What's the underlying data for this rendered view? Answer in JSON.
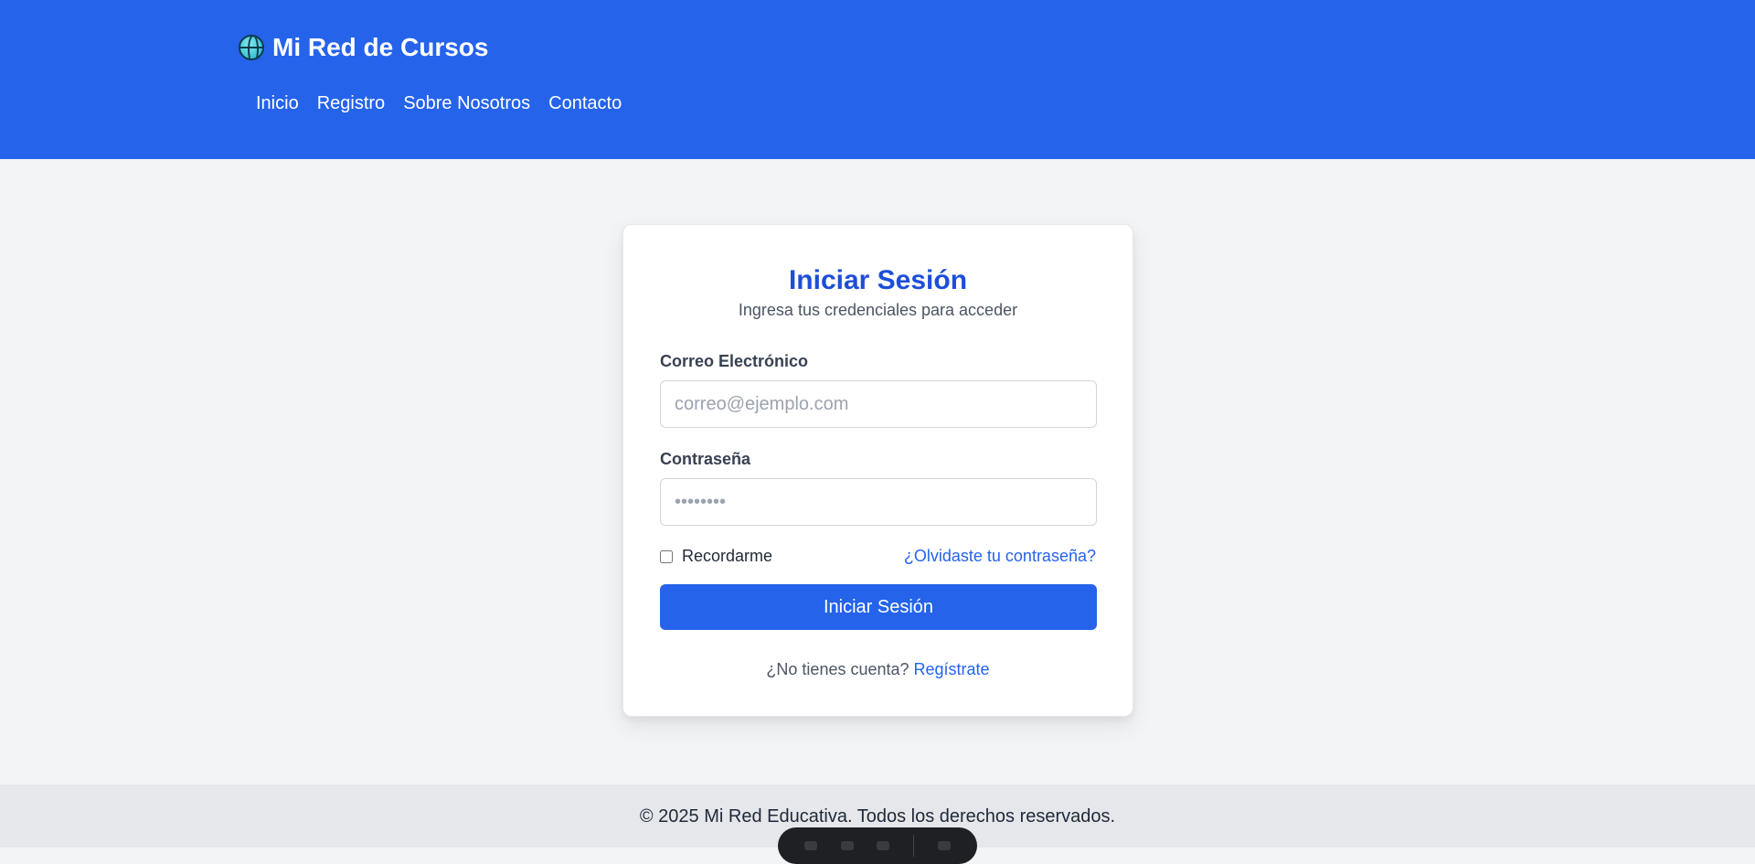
{
  "header": {
    "brand_icon": "globe-icon",
    "brand": "Mi Red de Cursos",
    "nav": [
      "Inicio",
      "Registro",
      "Sobre Nosotros",
      "Contacto"
    ]
  },
  "login": {
    "title": "Iniciar Sesión",
    "subtitle": "Ingresa tus credenciales para acceder",
    "email_label": "Correo Electrónico",
    "email_placeholder": "correo@ejemplo.com",
    "password_label": "Contraseña",
    "password_placeholder": "••••••••",
    "remember_label": "Recordarme",
    "forgot_link": "¿Olvidaste tu contraseña?",
    "submit_label": "Iniciar Sesión",
    "signup_prompt": "¿No tienes cuenta?",
    "signup_link": "Regístrate"
  },
  "footer": {
    "text": "© 2025 Mi Red Educativa. Todos los derechos reservados."
  },
  "colors": {
    "primary": "#2563eb",
    "title": "#1d4ed8",
    "background": "#f3f4f6"
  }
}
